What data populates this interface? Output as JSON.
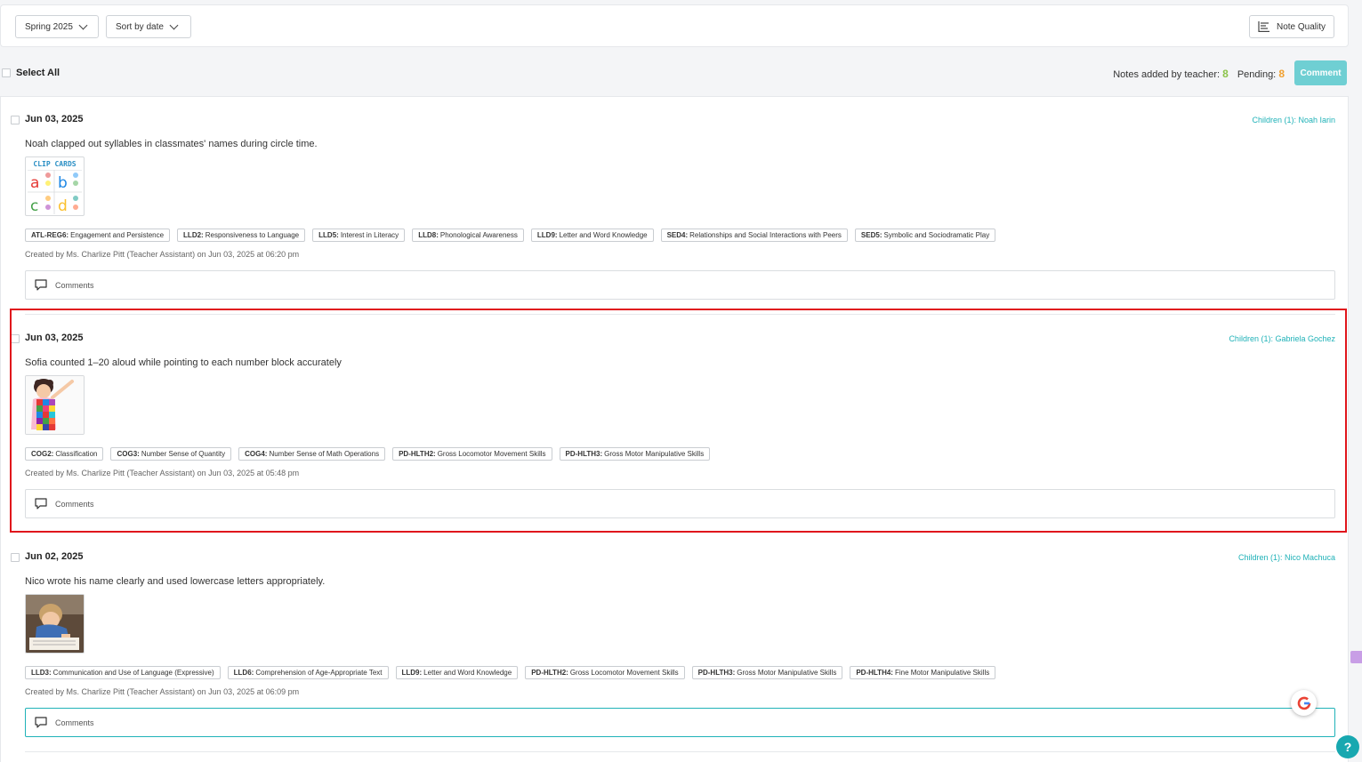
{
  "filters": {
    "term": "Spring 2025",
    "sort": "Sort by date",
    "note_quality": "Note Quality"
  },
  "selection": {
    "select_all": "Select All",
    "notes_added_label": "Notes added by teacher:",
    "notes_added_count": "8",
    "pending_label": "Pending:",
    "pending_count": "8",
    "comment_button": "Comment"
  },
  "notes": [
    {
      "date": "Jun 03, 2025",
      "children": "Children (1): Noah Iarin",
      "text": "Noah clapped out syllables in classmates' names during circle time.",
      "thumb_title": "CLIP CARDS",
      "tags": [
        {
          "code": "ATL-REG6:",
          "label": "Engagement and Persistence"
        },
        {
          "code": "LLD2:",
          "label": "Responsiveness to Language"
        },
        {
          "code": "LLD5:",
          "label": "Interest in Literacy"
        },
        {
          "code": "LLD8:",
          "label": "Phonological Awareness"
        },
        {
          "code": "LLD9:",
          "label": "Letter and Word Knowledge"
        },
        {
          "code": "SED4:",
          "label": "Relationships and Social Interactions with Peers"
        },
        {
          "code": "SED5:",
          "label": "Symbolic and Sociodramatic Play"
        }
      ],
      "meta": "Created by Ms. Charlize Pitt (Teacher Assistant) on Jun 03, 2025 at 06:20 pm",
      "comments": "Comments"
    },
    {
      "date": "Jun 03, 2025",
      "children": "Children (1): Gabriela Gochez",
      "text": "Sofia counted 1–20 aloud while pointing to each number block accurately",
      "tags": [
        {
          "code": "COG2:",
          "label": "Classification"
        },
        {
          "code": "COG3:",
          "label": "Number Sense of Quantity"
        },
        {
          "code": "COG4:",
          "label": "Number Sense of Math Operations"
        },
        {
          "code": "PD-HLTH2:",
          "label": "Gross Locomotor Movement Skills"
        },
        {
          "code": "PD-HLTH3:",
          "label": "Gross Motor Manipulative Skills"
        }
      ],
      "meta": "Created by Ms. Charlize Pitt (Teacher Assistant) on Jun 03, 2025 at 05:48 pm",
      "comments": "Comments"
    },
    {
      "date": "Jun 02, 2025",
      "children": "Children (1): Nico Machuca",
      "text": "Nico wrote his name clearly and used lowercase letters appropriately.",
      "tags": [
        {
          "code": "LLD3:",
          "label": "Communication and Use of Language (Expressive)"
        },
        {
          "code": "LLD6:",
          "label": "Comprehension of Age-Appropriate Text"
        },
        {
          "code": "LLD9:",
          "label": "Letter and Word Knowledge"
        },
        {
          "code": "PD-HLTH2:",
          "label": "Gross Locomotor Movement Skills"
        },
        {
          "code": "PD-HLTH3:",
          "label": "Gross Motor Manipulative Skills"
        },
        {
          "code": "PD-HLTH4:",
          "label": "Fine Motor Manipulative Skills"
        }
      ],
      "meta": "Created by Ms. Charlize Pitt (Teacher Assistant) on Jun 03, 2025 at 06:09 pm",
      "comments": "Comments"
    }
  ],
  "colors": {
    "accent": "#20b2b8",
    "highlight": "#e0151c",
    "teacher_count": "#8bc34a",
    "pending_count": "#f0a030"
  }
}
